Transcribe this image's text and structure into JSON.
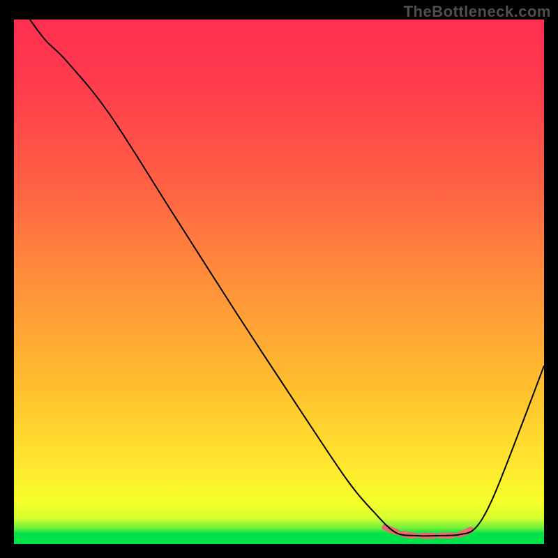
{
  "watermark": "TheBottleneck.com",
  "chart_data": {
    "type": "line",
    "title": "",
    "xlabel": "",
    "ylabel": "",
    "xlim": [
      0,
      100
    ],
    "ylim": [
      0,
      100
    ],
    "background_gradient": {
      "stops": [
        {
          "offset": 0,
          "color": "#00e24a"
        },
        {
          "offset": 2,
          "color": "#00e24a"
        },
        {
          "offset": 3,
          "color": "#6bf13a"
        },
        {
          "offset": 5,
          "color": "#d7ff2d"
        },
        {
          "offset": 8,
          "color": "#f6ff2a"
        },
        {
          "offset": 15,
          "color": "#ffe72f"
        },
        {
          "offset": 30,
          "color": "#ffbf2e"
        },
        {
          "offset": 50,
          "color": "#ff8f3b"
        },
        {
          "offset": 70,
          "color": "#ff5d44"
        },
        {
          "offset": 88,
          "color": "#ff3b4e"
        },
        {
          "offset": 100,
          "color": "#ff2f50"
        }
      ]
    },
    "series": [
      {
        "name": "bottleneck-curve",
        "color": "#000000",
        "stroke_width": 2,
        "points": [
          {
            "x": 3,
            "y": 100
          },
          {
            "x": 6,
            "y": 96
          },
          {
            "x": 10,
            "y": 92
          },
          {
            "x": 18,
            "y": 82
          },
          {
            "x": 30,
            "y": 63
          },
          {
            "x": 42,
            "y": 44
          },
          {
            "x": 55,
            "y": 24
          },
          {
            "x": 63,
            "y": 12
          },
          {
            "x": 68,
            "y": 6
          },
          {
            "x": 72,
            "y": 2.2
          },
          {
            "x": 76,
            "y": 1.6
          },
          {
            "x": 80,
            "y": 1.6
          },
          {
            "x": 84,
            "y": 1.8
          },
          {
            "x": 87,
            "y": 3.0
          },
          {
            "x": 90,
            "y": 8
          },
          {
            "x": 94,
            "y": 18
          },
          {
            "x": 100,
            "y": 34
          }
        ]
      },
      {
        "name": "flat-bottom-highlight",
        "color": "#e86b6b",
        "stroke_width": 9,
        "stroke_linecap": "round",
        "dash": "18 9",
        "points": [
          {
            "x": 70,
            "y": 3.2
          },
          {
            "x": 73,
            "y": 2.0
          },
          {
            "x": 76,
            "y": 1.6
          },
          {
            "x": 80,
            "y": 1.6
          },
          {
            "x": 84,
            "y": 1.8
          },
          {
            "x": 87,
            "y": 3.2
          }
        ]
      }
    ]
  }
}
